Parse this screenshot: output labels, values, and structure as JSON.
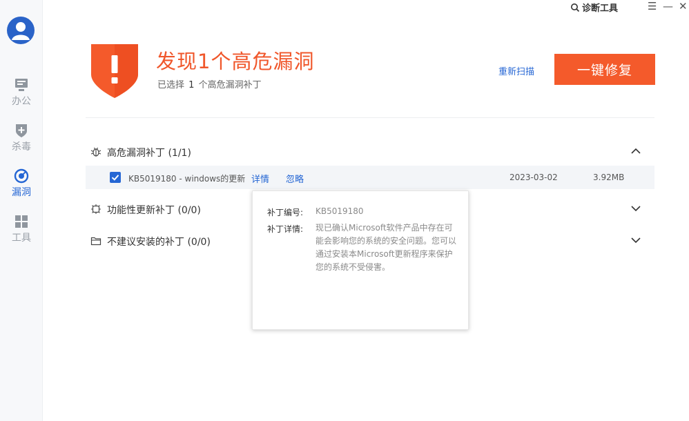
{
  "window": {
    "diagnose_label": "诊断工具",
    "menu_glyph": "☰",
    "minimize_glyph": "—",
    "close_glyph": "✕"
  },
  "sidebar": {
    "items": [
      {
        "label": "办公",
        "icon": "monitor-icon"
      },
      {
        "label": "杀毒",
        "icon": "shield-plus-icon"
      },
      {
        "label": "漏洞",
        "icon": "target-icon",
        "active": true
      },
      {
        "label": "工具",
        "icon": "grid-icon"
      }
    ]
  },
  "header": {
    "title": "发现1个高危漏洞",
    "subtitle_prefix": "已选择",
    "subtitle_count": "1",
    "subtitle_suffix": "个高危漏洞补丁",
    "rescan_label": "重新扫描",
    "fix_label": "一键修复"
  },
  "sections": [
    {
      "title": "高危漏洞补丁 (1/1)",
      "icon": "bug-icon",
      "expanded": true
    },
    {
      "title": "功能性更新补丁 (0/0)",
      "icon": "gear-bug-icon",
      "expanded": false
    },
    {
      "title": "不建议安装的补丁 (0/0)",
      "icon": "folder-icon",
      "expanded": false
    }
  ],
  "patch": {
    "checked": true,
    "name": "KB5019180 - windows的更新",
    "details_label": "详情",
    "ignore_label": "忽略",
    "date": "2023-03-02",
    "size": "3.92MB"
  },
  "tooltip": {
    "id_label": "补丁编号:",
    "id_value": "KB5019180",
    "desc_label": "补丁详情:",
    "desc_value": "现已确认Microsoft软件产品中存在可能会影响您的系统的安全问题。您可以通过安装本Microsoft更新程序来保护您的系统不受侵害。"
  },
  "colors": {
    "accent_orange": "#f45a2b",
    "title_orange": "#f0572b",
    "link_blue": "#2566d4",
    "avatar_blue": "#2a63c8"
  }
}
